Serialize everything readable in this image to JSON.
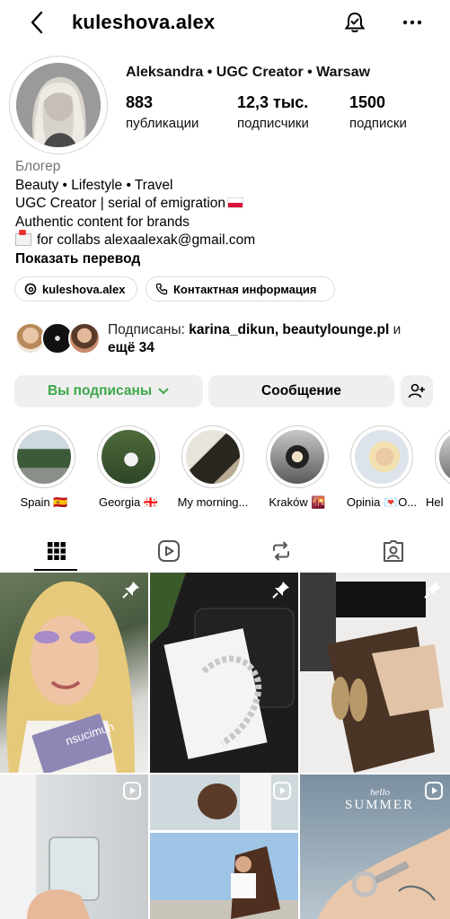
{
  "header": {
    "username": "kuleshova.alex"
  },
  "profile": {
    "display_name": "Aleksandra • UGC Creator • Warsaw",
    "stats": [
      {
        "value": "883",
        "label": "публикации"
      },
      {
        "value": "12,3 тыс.",
        "label": "подписчики"
      },
      {
        "value": "1500",
        "label": "подписки"
      }
    ],
    "bio": {
      "category": "Блогер",
      "line1": "Beauty • Lifestyle • Travel",
      "line2": "UGC Creator | serial of emigration",
      "line3": "Authentic content for brands",
      "line4": "for collabs alexaalexak@gmail.com",
      "translate": "Показать перевод"
    },
    "chips": [
      {
        "label": "kuleshova.alex",
        "icon": "threads-icon"
      },
      {
        "label": "Контактная информация",
        "icon": "phone-icon"
      }
    ],
    "followed_by": {
      "prefix": "Подписаны: ",
      "names": "karina_dikun, beautylounge.pl",
      "and": " и",
      "more": "ещё 34"
    }
  },
  "actions": {
    "following": "Вы подписаны",
    "message": "Сообщение"
  },
  "highlights": [
    {
      "label": "Spain 🇪🇸"
    },
    {
      "label": "Georgia 🇬🇪"
    },
    {
      "label": "My morning..."
    },
    {
      "label": "Kraków 🌇"
    },
    {
      "label": "Opinia 💌O..."
    },
    {
      "label": "Hel"
    }
  ],
  "tabs": [
    "grid-icon",
    "reels-icon",
    "reposts-icon",
    "tagged-icon"
  ],
  "grid": {
    "cell_texts": {
      "tile4_word": "nsucimun",
      "tile6_small": "hello",
      "tile6_big": "SUMMER"
    }
  },
  "colors": {
    "following_green": "#3ca84a",
    "button_bg": "#efefef",
    "muted": "#737373"
  }
}
